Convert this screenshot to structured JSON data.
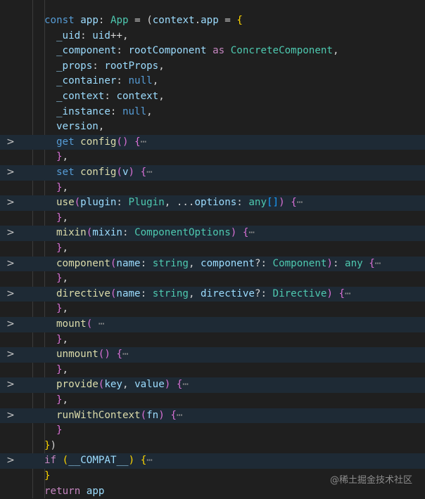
{
  "watermark": "@稀土掘金技术社区",
  "fold_chevron": ">",
  "lines": [
    {
      "indent": 0,
      "folded": false,
      "tokens": [
        [
          "kw",
          "const "
        ],
        [
          "id",
          "app"
        ],
        [
          "op",
          ": "
        ],
        [
          "ty",
          "App"
        ],
        [
          "op",
          " = ("
        ],
        [
          "id",
          "context"
        ],
        [
          "op",
          "."
        ],
        [
          "id",
          "app"
        ],
        [
          "op",
          " = "
        ],
        [
          "b1",
          "{"
        ]
      ]
    },
    {
      "indent": 1,
      "folded": false,
      "tokens": [
        [
          "id",
          "_uid"
        ],
        [
          "op",
          ": "
        ],
        [
          "id",
          "uid"
        ],
        [
          "op",
          "++,"
        ]
      ]
    },
    {
      "indent": 1,
      "folded": false,
      "tokens": [
        [
          "id",
          "_component"
        ],
        [
          "op",
          ": "
        ],
        [
          "id",
          "rootComponent"
        ],
        [
          "ctl",
          " as "
        ],
        [
          "ty",
          "ConcreteComponent"
        ],
        [
          "op",
          ","
        ]
      ]
    },
    {
      "indent": 1,
      "folded": false,
      "tokens": [
        [
          "id",
          "_props"
        ],
        [
          "op",
          ": "
        ],
        [
          "id",
          "rootProps"
        ],
        [
          "op",
          ","
        ]
      ]
    },
    {
      "indent": 1,
      "folded": false,
      "tokens": [
        [
          "id",
          "_container"
        ],
        [
          "op",
          ": "
        ],
        [
          "kw",
          "null"
        ],
        [
          "op",
          ","
        ]
      ]
    },
    {
      "indent": 1,
      "folded": false,
      "tokens": [
        [
          "id",
          "_context"
        ],
        [
          "op",
          ": "
        ],
        [
          "id",
          "context"
        ],
        [
          "op",
          ","
        ]
      ]
    },
    {
      "indent": 1,
      "folded": false,
      "tokens": [
        [
          "id",
          "_instance"
        ],
        [
          "op",
          ": "
        ],
        [
          "kw",
          "null"
        ],
        [
          "op",
          ","
        ]
      ]
    },
    {
      "indent": 1,
      "folded": false,
      "tokens": [
        [
          "id",
          "version"
        ],
        [
          "op",
          ","
        ]
      ]
    },
    {
      "indent": 1,
      "folded": true,
      "tokens": [
        [
          "kw",
          "get "
        ],
        [
          "fn",
          "config"
        ],
        [
          "b2",
          "()"
        ],
        [
          "op",
          " "
        ],
        [
          "b2",
          "{"
        ],
        [
          "dim",
          "⋯"
        ]
      ]
    },
    {
      "indent": 1,
      "folded": false,
      "tokens": [
        [
          "b2",
          "}"
        ],
        [
          "op",
          ","
        ]
      ]
    },
    {
      "indent": 1,
      "folded": true,
      "tokens": [
        [
          "kw",
          "set "
        ],
        [
          "fn",
          "config"
        ],
        [
          "b2",
          "("
        ],
        [
          "id",
          "v"
        ],
        [
          "b2",
          ")"
        ],
        [
          "op",
          " "
        ],
        [
          "b2",
          "{"
        ],
        [
          "dim",
          "⋯"
        ]
      ]
    },
    {
      "indent": 1,
      "folded": false,
      "tokens": [
        [
          "b2",
          "}"
        ],
        [
          "op",
          ","
        ]
      ]
    },
    {
      "indent": 1,
      "folded": true,
      "tokens": [
        [
          "fn",
          "use"
        ],
        [
          "b2",
          "("
        ],
        [
          "id",
          "plugin"
        ],
        [
          "op",
          ": "
        ],
        [
          "ty",
          "Plugin"
        ],
        [
          "op",
          ", ..."
        ],
        [
          "id",
          "options"
        ],
        [
          "op",
          ": "
        ],
        [
          "ty",
          "any"
        ],
        [
          "b3",
          "[]"
        ],
        [
          "b2",
          ")"
        ],
        [
          "op",
          " "
        ],
        [
          "b2",
          "{"
        ],
        [
          "dim",
          "⋯"
        ]
      ]
    },
    {
      "indent": 1,
      "folded": false,
      "tokens": [
        [
          "b2",
          "}"
        ],
        [
          "op",
          ","
        ]
      ]
    },
    {
      "indent": 1,
      "folded": true,
      "tokens": [
        [
          "fn",
          "mixin"
        ],
        [
          "b2",
          "("
        ],
        [
          "id",
          "mixin"
        ],
        [
          "op",
          ": "
        ],
        [
          "ty",
          "ComponentOptions"
        ],
        [
          "b2",
          ")"
        ],
        [
          "op",
          " "
        ],
        [
          "b2",
          "{"
        ],
        [
          "dim",
          "⋯"
        ]
      ]
    },
    {
      "indent": 1,
      "folded": false,
      "tokens": [
        [
          "b2",
          "}"
        ],
        [
          "op",
          ","
        ]
      ]
    },
    {
      "indent": 1,
      "folded": true,
      "tokens": [
        [
          "fn",
          "component"
        ],
        [
          "b2",
          "("
        ],
        [
          "id",
          "name"
        ],
        [
          "op",
          ": "
        ],
        [
          "ty",
          "string"
        ],
        [
          "op",
          ", "
        ],
        [
          "id",
          "component"
        ],
        [
          "op",
          "?: "
        ],
        [
          "ty",
          "Component"
        ],
        [
          "b2",
          ")"
        ],
        [
          "op",
          ": "
        ],
        [
          "ty",
          "any"
        ],
        [
          "op",
          " "
        ],
        [
          "b2",
          "{"
        ],
        [
          "dim",
          "⋯"
        ]
      ]
    },
    {
      "indent": 1,
      "folded": false,
      "tokens": [
        [
          "b2",
          "}"
        ],
        [
          "op",
          ","
        ]
      ]
    },
    {
      "indent": 1,
      "folded": true,
      "tokens": [
        [
          "fn",
          "directive"
        ],
        [
          "b2",
          "("
        ],
        [
          "id",
          "name"
        ],
        [
          "op",
          ": "
        ],
        [
          "ty",
          "string"
        ],
        [
          "op",
          ", "
        ],
        [
          "id",
          "directive"
        ],
        [
          "op",
          "?: "
        ],
        [
          "ty",
          "Directive"
        ],
        [
          "b2",
          ")"
        ],
        [
          "op",
          " "
        ],
        [
          "b2",
          "{"
        ],
        [
          "dim",
          "⋯"
        ]
      ]
    },
    {
      "indent": 1,
      "folded": false,
      "tokens": [
        [
          "b2",
          "}"
        ],
        [
          "op",
          ","
        ]
      ]
    },
    {
      "indent": 1,
      "folded": true,
      "tokens": [
        [
          "fn",
          "mount"
        ],
        [
          "b2",
          "("
        ],
        [
          "op",
          " "
        ],
        [
          "dim",
          "⋯"
        ]
      ]
    },
    {
      "indent": 1,
      "folded": false,
      "tokens": [
        [
          "b2",
          "}"
        ],
        [
          "op",
          ","
        ]
      ]
    },
    {
      "indent": 1,
      "folded": true,
      "tokens": [
        [
          "fn",
          "unmount"
        ],
        [
          "b2",
          "()"
        ],
        [
          "op",
          " "
        ],
        [
          "b2",
          "{"
        ],
        [
          "dim",
          "⋯"
        ]
      ]
    },
    {
      "indent": 1,
      "folded": false,
      "tokens": [
        [
          "b2",
          "}"
        ],
        [
          "op",
          ","
        ]
      ]
    },
    {
      "indent": 1,
      "folded": true,
      "tokens": [
        [
          "fn",
          "provide"
        ],
        [
          "b2",
          "("
        ],
        [
          "id",
          "key"
        ],
        [
          "op",
          ", "
        ],
        [
          "id",
          "value"
        ],
        [
          "b2",
          ")"
        ],
        [
          "op",
          " "
        ],
        [
          "b2",
          "{"
        ],
        [
          "dim",
          "⋯"
        ]
      ]
    },
    {
      "indent": 1,
      "folded": false,
      "tokens": [
        [
          "b2",
          "}"
        ],
        [
          "op",
          ","
        ]
      ]
    },
    {
      "indent": 1,
      "folded": true,
      "tokens": [
        [
          "fn",
          "runWithContext"
        ],
        [
          "b2",
          "("
        ],
        [
          "id",
          "fn"
        ],
        [
          "b2",
          ")"
        ],
        [
          "op",
          " "
        ],
        [
          "b2",
          "{"
        ],
        [
          "dim",
          "⋯"
        ]
      ]
    },
    {
      "indent": 1,
      "folded": false,
      "tokens": [
        [
          "b2",
          "}"
        ]
      ]
    },
    {
      "indent": 0,
      "folded": false,
      "tokens": [
        [
          "b1",
          "}"
        ],
        [
          "op",
          ")"
        ]
      ]
    },
    {
      "indent": 0,
      "folded": true,
      "tokens": [
        [
          "ctl",
          "if"
        ],
        [
          "op",
          " "
        ],
        [
          "b1",
          "("
        ],
        [
          "id",
          "__COMPAT__"
        ],
        [
          "b1",
          ")"
        ],
        [
          "op",
          " "
        ],
        [
          "b1",
          "{"
        ],
        [
          "dim",
          "⋯"
        ]
      ]
    },
    {
      "indent": 0,
      "folded": false,
      "tokens": [
        [
          "b1",
          "}"
        ]
      ]
    },
    {
      "indent": 0,
      "folded": false,
      "tokens": [
        [
          "ctl",
          "return "
        ],
        [
          "id",
          "app"
        ]
      ]
    }
  ]
}
